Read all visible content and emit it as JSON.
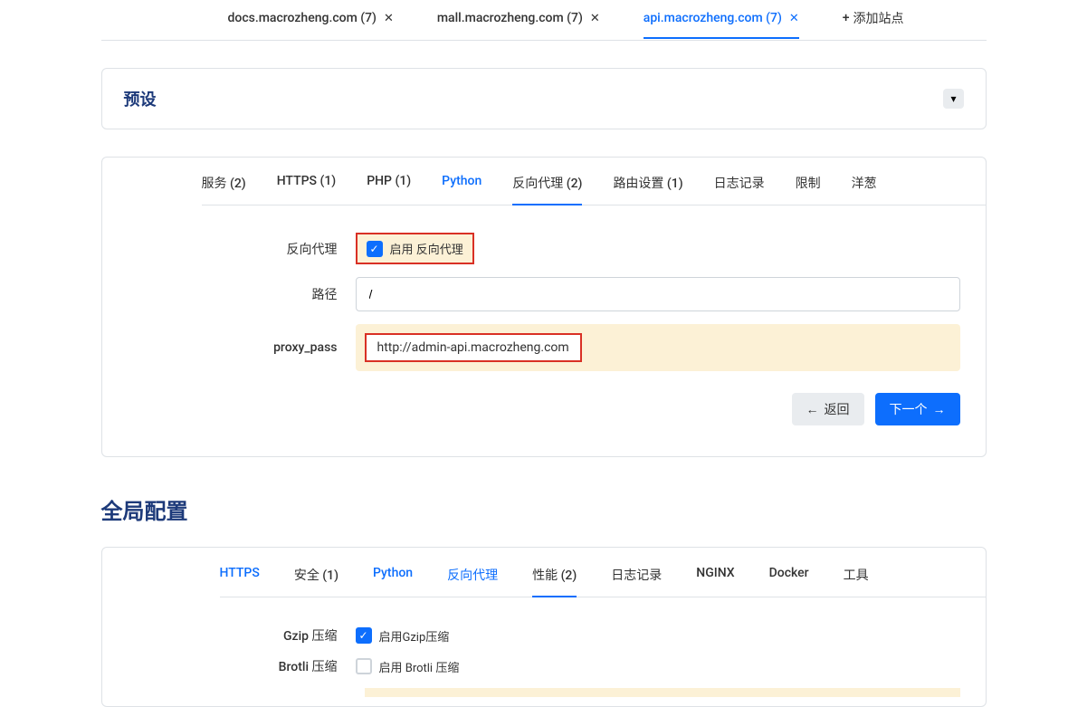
{
  "topTabs": [
    {
      "label": "docs.macrozheng.com (7)",
      "active": false
    },
    {
      "label": "mall.macrozheng.com (7)",
      "active": false
    },
    {
      "label": "api.macrozheng.com (7)",
      "active": true
    }
  ],
  "addSite": "添加站点",
  "preset": {
    "title": "预设"
  },
  "configTabs": [
    {
      "label": "服务 (2)",
      "type": "text"
    },
    {
      "label": "HTTPS (1)",
      "type": "text"
    },
    {
      "label": "PHP (1)",
      "type": "text"
    },
    {
      "label": "Python",
      "type": "link"
    },
    {
      "label": "反向代理 (2)",
      "type": "active"
    },
    {
      "label": "路由设置 (1)",
      "type": "text"
    },
    {
      "label": "日志记录",
      "type": "text"
    },
    {
      "label": "限制",
      "type": "text"
    },
    {
      "label": "洋葱",
      "type": "text"
    }
  ],
  "form": {
    "reverseProxyLabel": "反向代理",
    "enableReverseProxy": "启用 反向代理",
    "pathLabel": "路径",
    "pathValue": "/",
    "proxyPassLabel": "proxy_pass",
    "proxyPassValue": "http://admin-api.macrozheng.com"
  },
  "buttons": {
    "back": "返回",
    "next": "下一个"
  },
  "globalTitle": "全局配置",
  "globalTabs": [
    {
      "label": "HTTPS",
      "type": "link"
    },
    {
      "label": "安全 (1)",
      "type": "text"
    },
    {
      "label": "Python",
      "type": "link"
    },
    {
      "label": "反向代理",
      "type": "link"
    },
    {
      "label": "性能 (2)",
      "type": "active"
    },
    {
      "label": "日志记录",
      "type": "text"
    },
    {
      "label": "NGINX",
      "type": "text"
    },
    {
      "label": "Docker",
      "type": "text"
    },
    {
      "label": "工具",
      "type": "text"
    }
  ],
  "globalForm": {
    "gzipLabel": "Gzip 压缩",
    "gzipEnable": "启用Gzip压缩",
    "brotliLabel": "Brotli 压缩",
    "brotliEnable": "启用 Brotli 压缩"
  }
}
